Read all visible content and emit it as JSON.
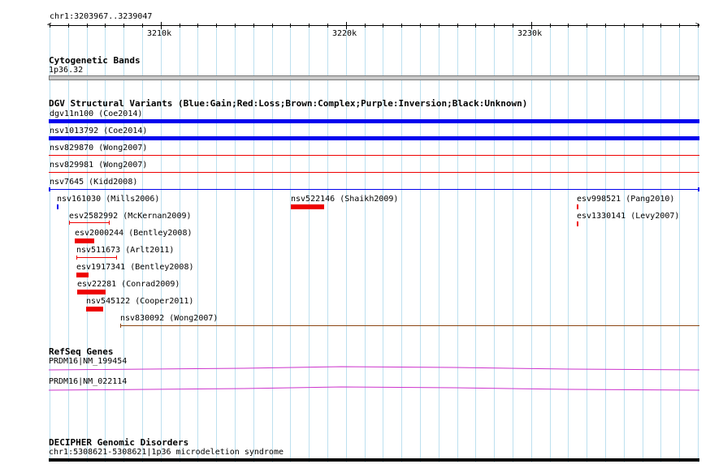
{
  "ruler": {
    "location": "chr1:3203967..3239047",
    "ticks": [
      "3210k",
      "3220k",
      "3230k"
    ]
  },
  "cytoband": {
    "title": "Cytogenetic Bands",
    "band": "1p36.32"
  },
  "dgv": {
    "title": "DGV Structural Variants (Blue:Gain;Red:Loss;Brown:Complex;Purple:Inversion;Black:Unknown)",
    "colors": {
      "gain": "#0000ee",
      "loss": "#ee0000",
      "complex": "#8b4513"
    },
    "rows": [
      {
        "label": "dgv11n100 (Coe2014)",
        "type": "gain"
      },
      {
        "label": "nsv1013792 (Coe2014)",
        "type": "gain"
      },
      {
        "label": "nsv829870 (Wong2007)",
        "type": "loss"
      },
      {
        "label": "nsv829981 (Wong2007)",
        "type": "loss"
      },
      {
        "label": "nsv7645 (Kidd2008)",
        "type": "gain"
      }
    ],
    "small": [
      {
        "label": "nsv161030 (Mills2006)",
        "type": "gain"
      },
      {
        "label": "nsv522146 (Shaikh2009)",
        "type": "loss"
      },
      {
        "label": "esv998521 (Pang2010)",
        "type": "loss"
      },
      {
        "label": "esv2582992 (McKernan2009)",
        "type": "loss"
      },
      {
        "label": "esv1330141 (Levy2007)",
        "type": "loss"
      },
      {
        "label": "esv2000244 (Bentley2008)",
        "type": "loss"
      },
      {
        "label": "nsv511673 (Arlt2011)",
        "type": "loss"
      },
      {
        "label": "esv1917341 (Bentley2008)",
        "type": "loss"
      },
      {
        "label": "esv22281 (Conrad2009)",
        "type": "loss"
      },
      {
        "label": "nsv545122 (Cooper2011)",
        "type": "loss"
      },
      {
        "label": "nsv830092 (Wong2007)",
        "type": "complex"
      }
    ]
  },
  "refseq": {
    "title": "RefSeq Genes",
    "genes": [
      "PRDM16|NM_199454",
      "PRDM16|NM_022114"
    ]
  },
  "decipher": {
    "title": "DECIPHER Genomic Disorders",
    "item": "chr1:5308621-5308621|1p36 microdeletion syndrome"
  }
}
